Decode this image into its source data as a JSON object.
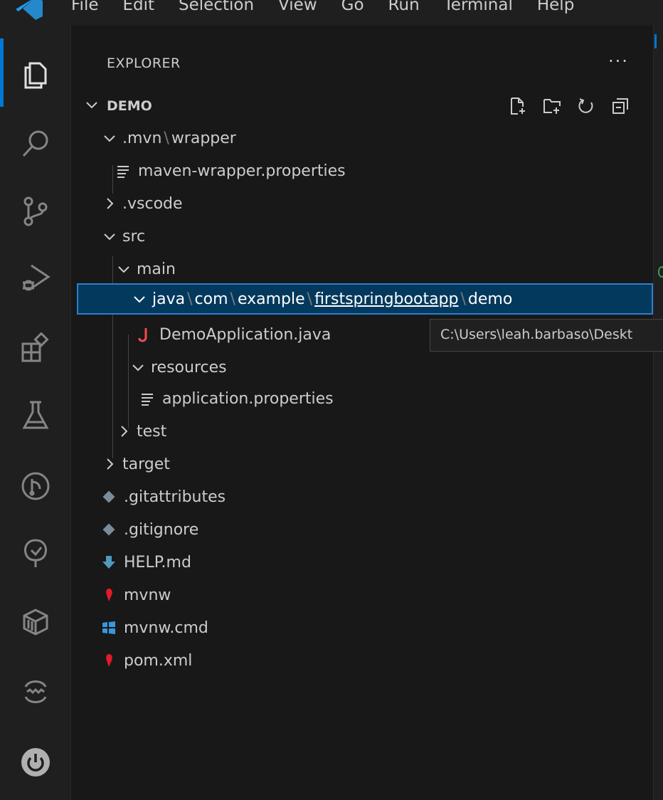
{
  "menu": [
    "File",
    "Edit",
    "Selection",
    "View",
    "Go",
    "Run",
    "Terminal",
    "Help"
  ],
  "explorer": {
    "title": "EXPLORER",
    "more": "···"
  },
  "section": {
    "title": "DEMO"
  },
  "tree": [
    {
      "parts": [
        ".mvn",
        "wrapper"
      ]
    },
    {
      "label": "maven-wrapper.properties"
    },
    {
      "label": ".vscode"
    },
    {
      "label": "src"
    },
    {
      "label": "main"
    },
    {
      "parts": [
        "java",
        "com",
        "example",
        "firstspringbootapp",
        "demo"
      ]
    },
    {
      "label": "DemoApplication.java"
    },
    {
      "label": "resources"
    },
    {
      "label": "application.properties"
    },
    {
      "label": "test"
    },
    {
      "label": "target"
    },
    {
      "label": ".gitattributes"
    },
    {
      "label": ".gitignore"
    },
    {
      "label": "HELP.md"
    },
    {
      "label": "mvnw"
    },
    {
      "label": "mvnw.cmd"
    },
    {
      "label": "pom.xml"
    }
  ],
  "tooltip": "C:\\Users\\leah.barbaso\\Deskt",
  "icons": {
    "activity": [
      "explorer-icon",
      "search-icon",
      "source-control-icon",
      "run-debug-icon",
      "extensions-icon",
      "testing-icon",
      "git-graph-icon",
      "spring-tree-icon",
      "package-icon",
      "remote-icon",
      "power-icon"
    ],
    "section_actions": [
      "new-file-icon",
      "new-folder-icon",
      "refresh-icon",
      "collapse-all-icon"
    ]
  },
  "colors": {
    "accent": "#0078d4",
    "selection": "#04395e",
    "java": "#f14c4c",
    "git": "#7a8b99",
    "markdown": "#519aba",
    "windows": "#3a96dd"
  }
}
